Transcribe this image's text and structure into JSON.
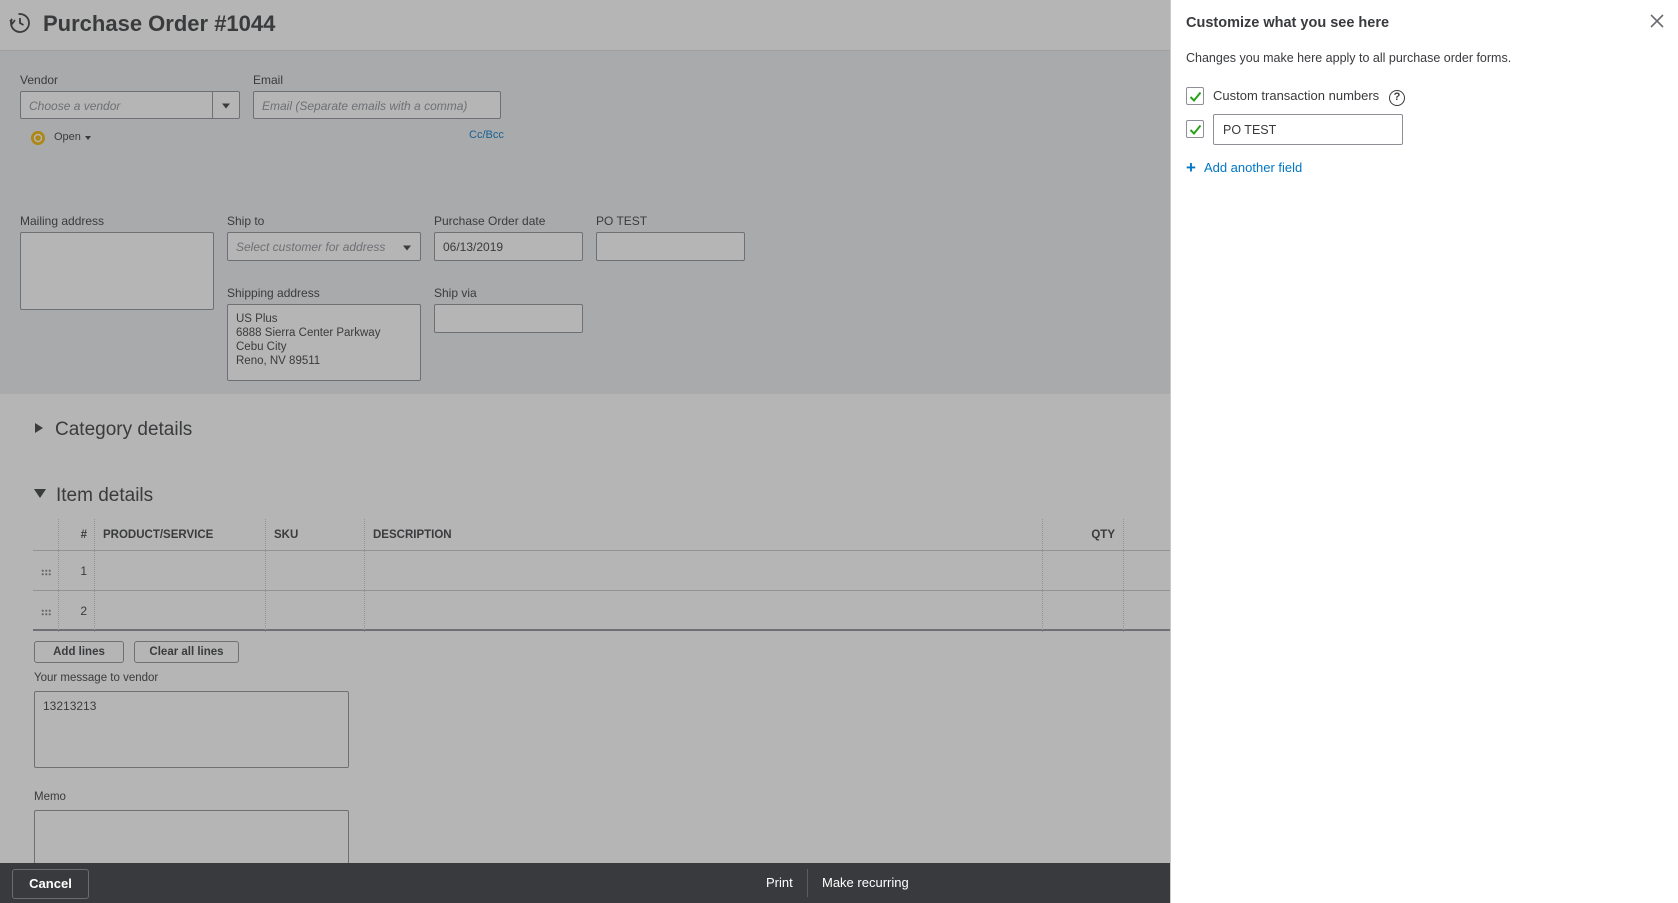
{
  "header": {
    "title": "Purchase Order #1044",
    "history_icon": "history-clock-icon"
  },
  "vendor": {
    "label": "Vendor",
    "placeholder": "Choose a vendor",
    "status": "Open"
  },
  "email": {
    "label": "Email",
    "placeholder": "Email (Separate emails with a comma)",
    "ccbcc": "Cc/Bcc"
  },
  "mailing_address": {
    "label": "Mailing address",
    "value": ""
  },
  "ship_to": {
    "label": "Ship to",
    "placeholder": "Select customer for address"
  },
  "po_date": {
    "label": "Purchase Order date",
    "value": "06/13/2019"
  },
  "po_test": {
    "label": "PO TEST",
    "value": ""
  },
  "shipping_address": {
    "label": "Shipping address",
    "lines": [
      "US Plus",
      "6888 Sierra Center Parkway",
      "Cebu City",
      "Reno, NV  89511"
    ]
  },
  "ship_via": {
    "label": "Ship via",
    "value": ""
  },
  "category_details": {
    "label": "Category details"
  },
  "item_details": {
    "label": "Item details",
    "columns": [
      "#",
      "PRODUCT/SERVICE",
      "SKU",
      "DESCRIPTION",
      "QTY"
    ],
    "rows": [
      {
        "num": "1",
        "product": "",
        "sku": "",
        "description": "",
        "qty": ""
      },
      {
        "num": "2",
        "product": "",
        "sku": "",
        "description": "",
        "qty": ""
      }
    ],
    "add_lines": "Add lines",
    "clear_lines": "Clear all lines"
  },
  "message": {
    "label": "Your message to vendor",
    "value": "13213213"
  },
  "memo": {
    "label": "Memo",
    "value": ""
  },
  "footer": {
    "cancel": "Cancel",
    "print": "Print",
    "make_recurring": "Make recurring"
  },
  "panel": {
    "title": "Customize what you see here",
    "description": "Changes you make here apply to all purchase order forms.",
    "custom_numbers_label": "Custom transaction numbers",
    "custom_numbers_checked": true,
    "custom_field_checked": true,
    "custom_field_value": "PO TEST",
    "add_field": "Add another field",
    "help_symbol": "?"
  },
  "colors": {
    "accent": "#0077c5",
    "check": "#2ca01c",
    "footer_bg": "#393a3d",
    "status_icon": "#f2b600"
  }
}
